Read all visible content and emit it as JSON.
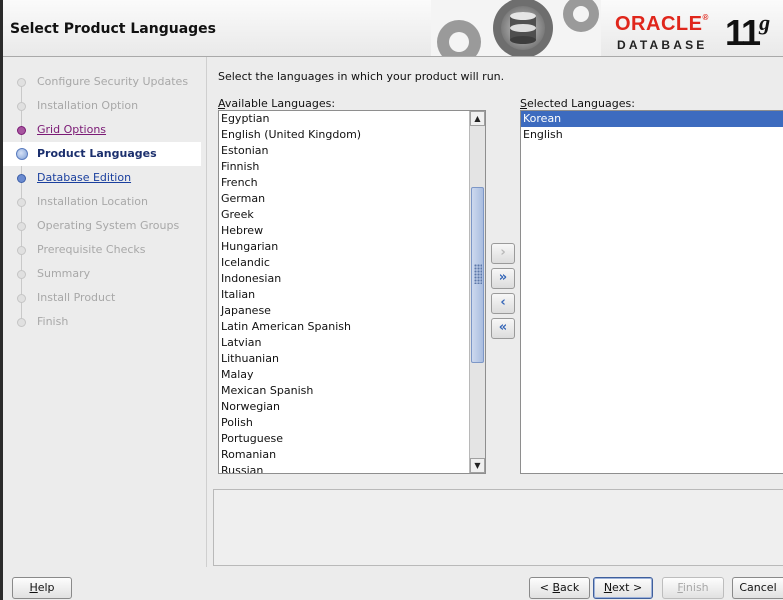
{
  "window": {
    "title": "Select Product Languages"
  },
  "branding": {
    "oracle": "ORACLE",
    "registered": "®",
    "database": "DATABASE",
    "version_number": "11",
    "version_letter": "g",
    "oracle_red": "#e0261b"
  },
  "steps": [
    {
      "label": "Configure Security Updates",
      "state": "disabled"
    },
    {
      "label": "Installation Option",
      "state": "disabled"
    },
    {
      "label": "Grid Options",
      "state": "visited-link"
    },
    {
      "label": "Product Languages",
      "state": "current"
    },
    {
      "label": "Database Edition",
      "state": "link"
    },
    {
      "label": "Installation Location",
      "state": "disabled"
    },
    {
      "label": "Operating System Groups",
      "state": "disabled"
    },
    {
      "label": "Prerequisite Checks",
      "state": "disabled"
    },
    {
      "label": "Summary",
      "state": "disabled"
    },
    {
      "label": "Install Product",
      "state": "disabled"
    },
    {
      "label": "Finish",
      "state": "disabled"
    }
  ],
  "main": {
    "instruction": "Select the languages in which your product will run.",
    "available_label_mnemonic": "A",
    "available_label_rest": "vailable Languages:",
    "selected_label_mnemonic": "S",
    "selected_label_rest": "elected Languages:",
    "available_languages": [
      "Egyptian",
      "English (United Kingdom)",
      "Estonian",
      "Finnish",
      "French",
      "German",
      "Greek",
      "Hebrew",
      "Hungarian",
      "Icelandic",
      "Indonesian",
      "Italian",
      "Japanese",
      "Latin American Spanish",
      "Latvian",
      "Lithuanian",
      "Malay",
      "Mexican Spanish",
      "Norwegian",
      "Polish",
      "Portuguese",
      "Romanian",
      "Russian"
    ],
    "selected_languages": [
      "Korean",
      "English"
    ],
    "selected_highlight": "Korean",
    "scroll_position_fraction": 0.26,
    "move_buttons": {
      "add_one": "›",
      "add_all": "»",
      "remove_one": "‹",
      "remove_all": "«"
    }
  },
  "footer": {
    "help_mnemonic": "H",
    "help_rest": "elp",
    "back_prefix": "< ",
    "back_mnemonic": "B",
    "back_rest": "ack",
    "next_mnemonic": "N",
    "next_rest": "ext >",
    "finish_mnemonic": "F",
    "finish_rest": "inish",
    "cancel": "Cancel"
  },
  "icons": {
    "step_indicator": "step-dot-icon",
    "scroll_up": "arrow-up-icon",
    "scroll_down": "arrow-down-icon"
  }
}
